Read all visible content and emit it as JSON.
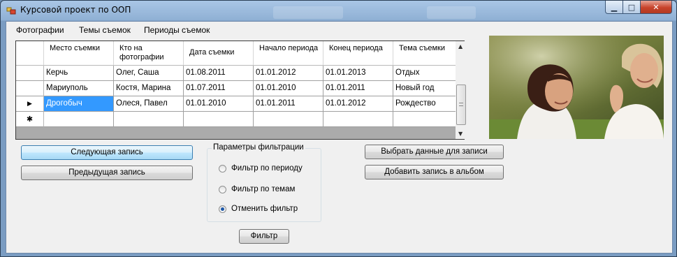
{
  "window": {
    "title": "Курсовой проект по ООП",
    "controls": {
      "minimize": "▁",
      "maximize": "□",
      "close": "✕"
    }
  },
  "menu": [
    "Фотографии",
    "Темы съемок",
    "Периоды съемок"
  ],
  "grid": {
    "headers": [
      "Место съемки",
      "Кто на фотографии",
      "Дата съемки",
      "Начало периода",
      "Конец периода",
      "Тема съемки"
    ],
    "rows": [
      {
        "marker": "",
        "cells": [
          "Керчь",
          "Олег, Саша",
          "01.08.2011",
          "01.01.2012",
          "01.01.2013",
          "Отдых"
        ]
      },
      {
        "marker": "",
        "cells": [
          "Мариуполь",
          "Костя, Марина",
          "01.07.2011",
          "01.01.2010",
          "01.01.2011",
          "Новый год"
        ]
      },
      {
        "marker": "▶",
        "cells": [
          "Дрогобыч",
          "Олеся, Павел",
          "01.01.2010",
          "01.01.2011",
          "01.01.2012",
          "Рождество"
        ]
      }
    ],
    "new_row_marker": "✱",
    "selected": {
      "row": 2,
      "col": 0
    }
  },
  "buttons": {
    "next": "Следующая запись",
    "prev": "Предыдущая запись",
    "select": "Выбрать данные для записи",
    "add": "Добавить запись в альбом",
    "filter": "Фильтр"
  },
  "filter_group": {
    "title": "Параметры фильтрации",
    "options": [
      {
        "label": "Фильтр по периоду",
        "checked": false
      },
      {
        "label": "Фильтр по темам",
        "checked": false
      },
      {
        "label": "Отменить фильтр",
        "checked": true
      }
    ]
  },
  "colors": {
    "selection": "#3399ff",
    "titlebar": "#a9c6e6",
    "close": "#c7432b"
  }
}
